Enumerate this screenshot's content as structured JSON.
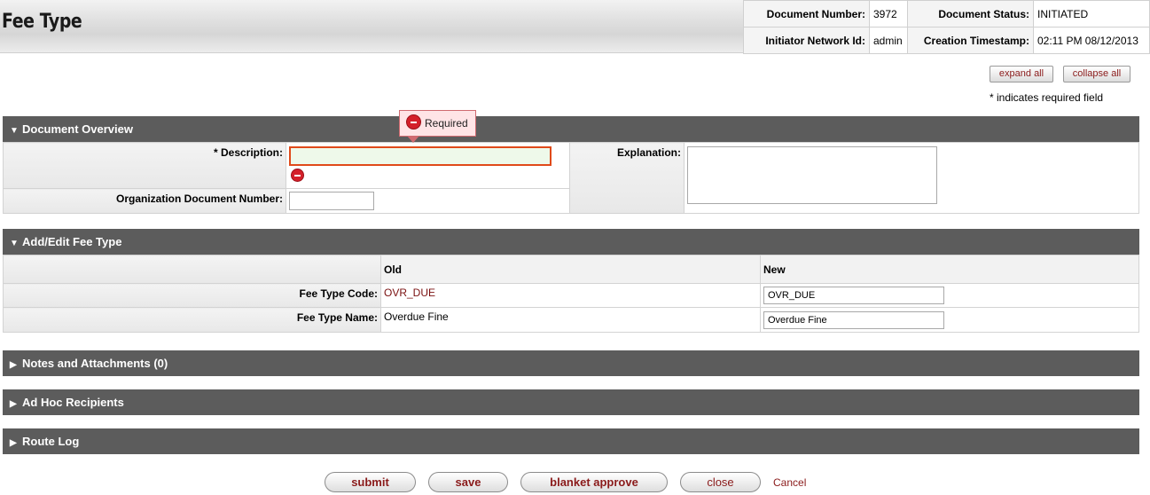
{
  "header": {
    "title": "Fee Type",
    "doc_number_label": "Document Number:",
    "doc_number": "3972",
    "doc_status_label": "Document Status:",
    "doc_status": "INITIATED",
    "initiator_label": "Initiator Network Id:",
    "initiator": "admin",
    "timestamp_label": "Creation Timestamp:",
    "timestamp": "02:11 PM 08/12/2013"
  },
  "toolbar": {
    "expand_all": "expand all",
    "collapse_all": "collapse all",
    "required_note": "* indicates required field"
  },
  "overview": {
    "title": "Document Overview",
    "description_label": "* Description:",
    "description_value": "",
    "tooltip": "Required",
    "org_doc_label": "Organization Document Number:",
    "org_doc_value": "",
    "explanation_label": "Explanation:",
    "explanation_value": ""
  },
  "fee_type": {
    "title": "Add/Edit Fee Type",
    "old_header": "Old",
    "new_header": "New",
    "rows": [
      {
        "label": "Fee Type Code:",
        "old": "OVR_DUE",
        "new": "OVR_DUE"
      },
      {
        "label": "Fee Type Name:",
        "old": "Overdue Fine",
        "new": "Overdue Fine"
      }
    ]
  },
  "sections": {
    "notes": "Notes and Attachments (0)",
    "adhoc": "Ad Hoc Recipients",
    "route_log": "Route Log"
  },
  "buttons": {
    "submit": "submit",
    "save": "save",
    "blanket_approve": "blanket approve",
    "close": "close",
    "cancel": "Cancel"
  },
  "colors": {
    "section_bar": "#5c5c5c",
    "error": "#d4202a",
    "link": "#8a1a1a"
  }
}
